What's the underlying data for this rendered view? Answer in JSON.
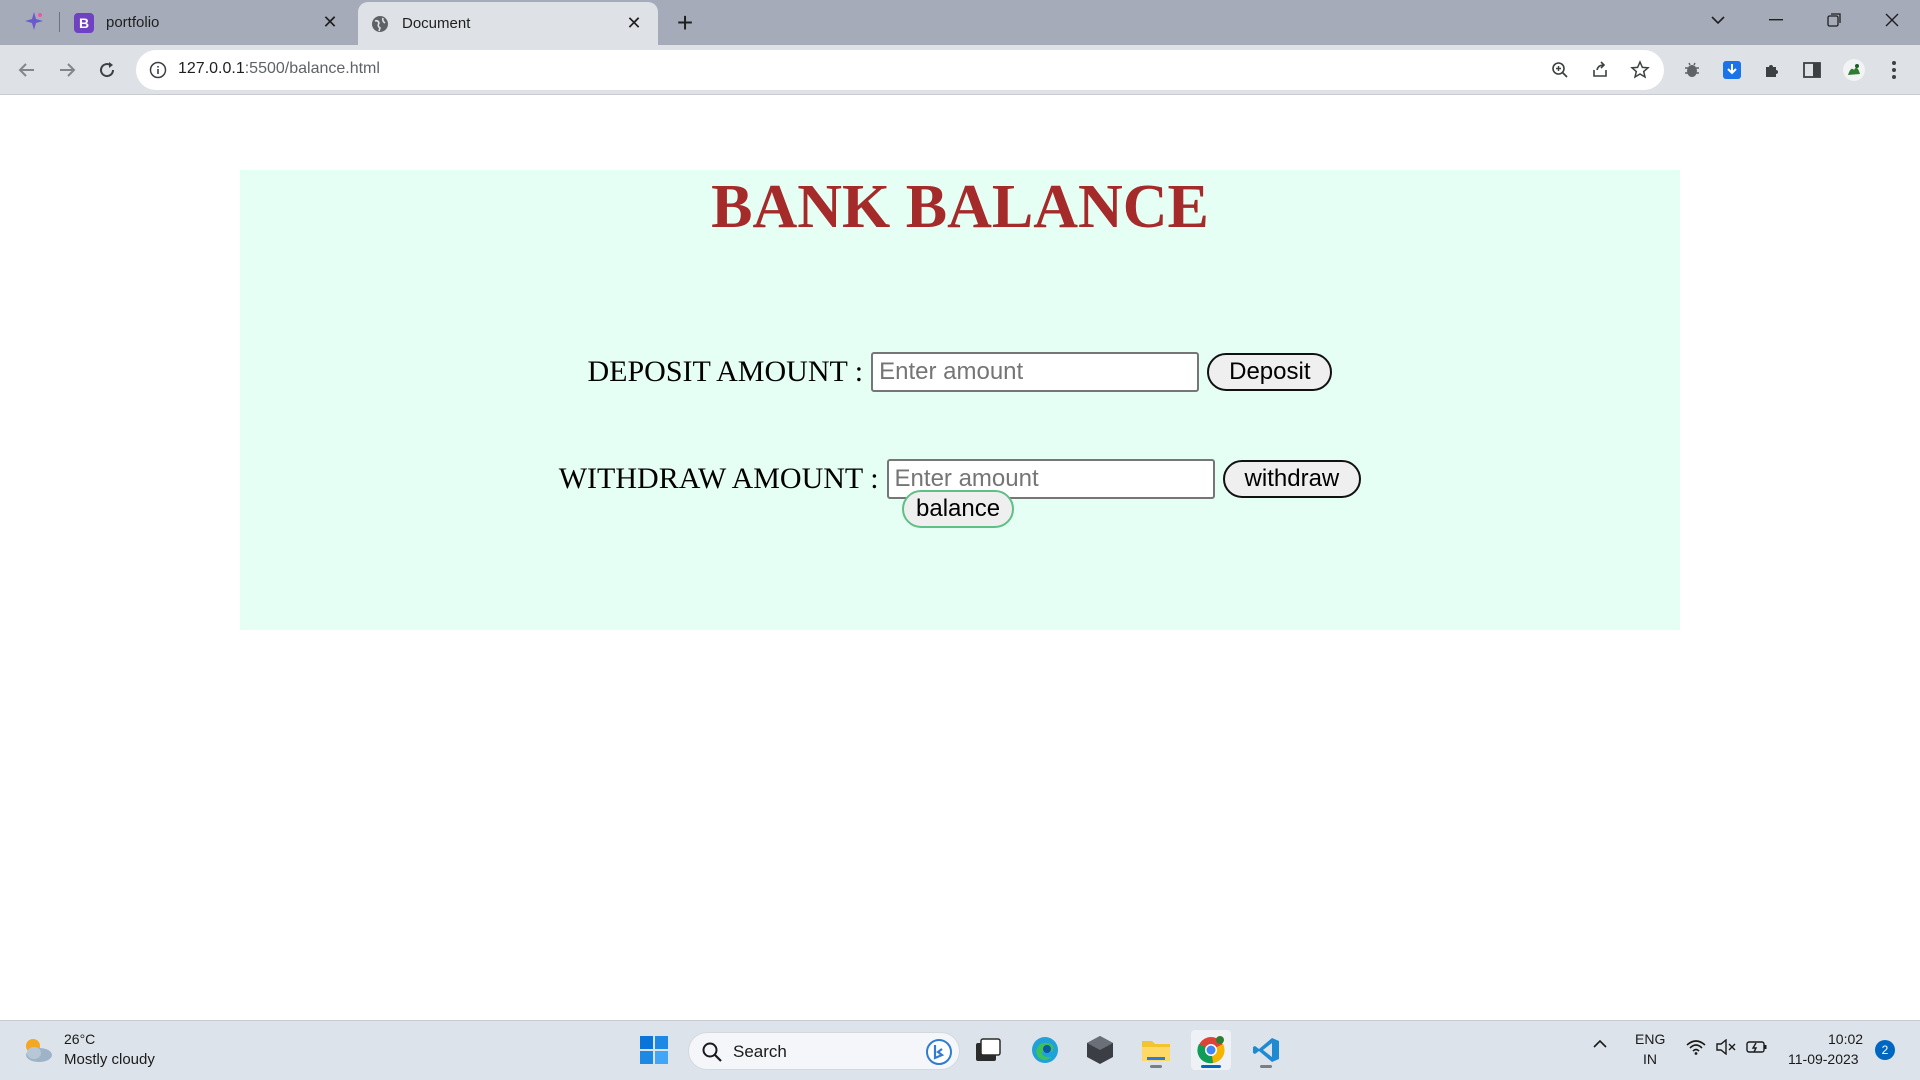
{
  "browser": {
    "tabs": [
      {
        "title": "portfolio",
        "favicon": "bootstrap-b-icon",
        "favicon_letter": "B",
        "active": false
      },
      {
        "title": "Document",
        "favicon": "globe-icon",
        "active": true
      }
    ],
    "address": {
      "host": "127.0.0.1",
      "path": ":5500/balance.html"
    }
  },
  "page": {
    "title": "BANK BALANCE",
    "deposit": {
      "label": "DEPOSIT AMOUNT :",
      "placeholder": "Enter amount",
      "value": "",
      "button": "Deposit"
    },
    "withdraw": {
      "label": "WITHDRAW AMOUNT :",
      "placeholder": "Enter amount",
      "value": "",
      "button": "withdraw"
    },
    "balance_button": "balance",
    "colors": {
      "panel_bg": "#e6fff5",
      "title": "#a52a2a",
      "balance_border": "#5fbf87"
    }
  },
  "taskbar": {
    "weather": {
      "temp": "26°C",
      "desc": "Mostly cloudy"
    },
    "search": {
      "label": "Search"
    },
    "apps": [
      "windows-start-icon",
      "task-view-icon",
      "edge-icon",
      "app-icon",
      "file-explorer-icon",
      "chrome-icon",
      "vscode-icon"
    ],
    "tray": {
      "lang": "ENG",
      "region": "IN",
      "time": "10:02",
      "date": "11-09-2023",
      "notifications": "2"
    }
  }
}
